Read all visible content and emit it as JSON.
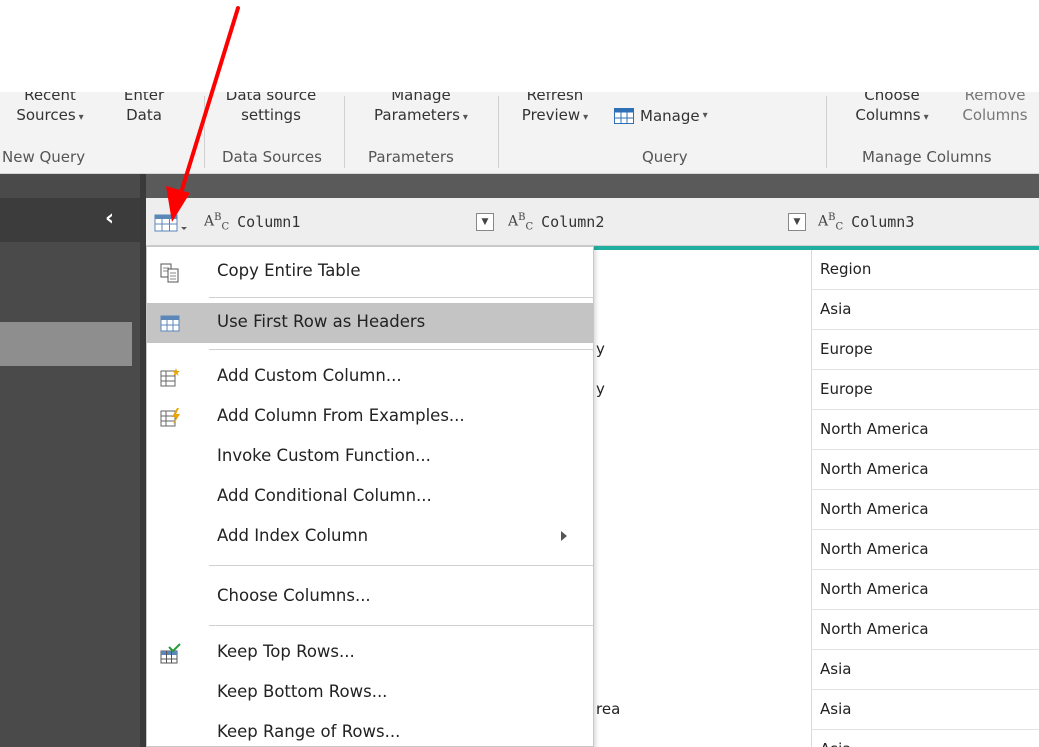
{
  "ribbon": {
    "recent_sources": [
      "Recent",
      "Sources"
    ],
    "enter_data": [
      "Enter",
      "Data"
    ],
    "data_source_settings": [
      "Data source",
      "settings"
    ],
    "manage_parameters": [
      "Manage",
      "Parameters"
    ],
    "refresh_preview": [
      "Refresh",
      "Preview"
    ],
    "manage": "Manage",
    "choose_columns": [
      "Choose",
      "Columns"
    ],
    "remove_columns": [
      "Remove",
      "Columns"
    ],
    "groups": {
      "new_query": "New Query",
      "data_sources": "Data Sources",
      "parameters": "Parameters",
      "query": "Query",
      "manage_columns": "Manage Columns"
    }
  },
  "grid": {
    "columns": [
      "Column1",
      "Column2",
      "Column3"
    ],
    "type_icon": {
      "a": "A",
      "b": "B",
      "c": "C"
    },
    "column3_values": [
      "Region",
      "Asia",
      "Europe",
      "Europe",
      "North America",
      "North America",
      "North America",
      "North America",
      "North America",
      "North America",
      "Asia",
      "Asia",
      "Asia"
    ],
    "column2_fragments": [
      "y",
      "y",
      "rea"
    ]
  },
  "context_menu": {
    "items": [
      {
        "label": "Copy Entire Table",
        "icon": "copy-icon"
      },
      {
        "label": "Use First Row as Headers",
        "icon": "table-headers-icon",
        "selected": true
      },
      {
        "label": "Add Custom Column...",
        "icon": "custom-column-icon"
      },
      {
        "label": "Add Column From Examples...",
        "icon": "column-from-examples-icon"
      },
      {
        "label": "Invoke Custom Function..."
      },
      {
        "label": "Add Conditional Column..."
      },
      {
        "label": "Add Index Column",
        "submenu": true
      },
      {
        "label": "Choose Columns..."
      },
      {
        "label": "Keep Top Rows...",
        "icon": "keep-top-rows-icon"
      },
      {
        "label": "Keep Bottom Rows..."
      },
      {
        "label": "Keep Range of Rows..."
      }
    ]
  },
  "colors": {
    "accent_teal": "#1fae9f",
    "annotation_arrow": "#ff0000",
    "menu_selected": "#c4c4c4"
  }
}
